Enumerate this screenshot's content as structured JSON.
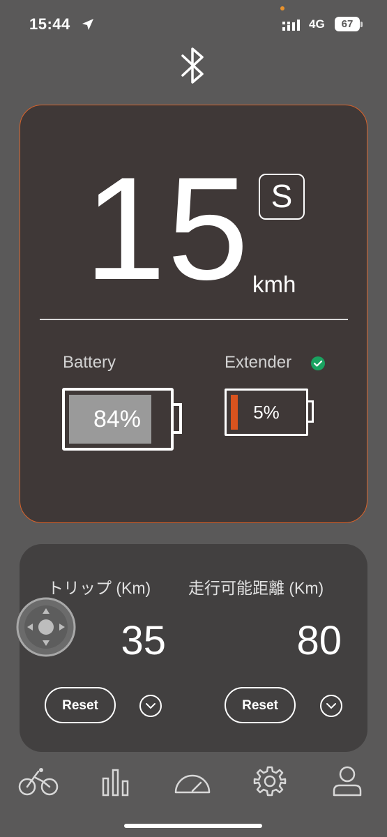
{
  "status_bar": {
    "time": "15:44",
    "network": "4G",
    "battery": "67"
  },
  "speed_card": {
    "speed": "15",
    "mode": "S",
    "unit": "kmh",
    "battery_label": "Battery",
    "battery_percent": "84%",
    "battery_level": 0.84,
    "extender_label": "Extender",
    "extender_percent": "5%",
    "extender_level": 0.05
  },
  "trip_card": {
    "trip_label": "トリップ (Km)",
    "trip_value": "35",
    "range_label": "走行可能距離 (Km)",
    "range_value": "80",
    "reset_label": "Reset"
  },
  "icons": {
    "bluetooth": "bluetooth-icon",
    "location": "location-arrow-icon",
    "check": "check-circle-icon",
    "joystick": "joystick-icon",
    "nav": [
      "bike-icon",
      "bar-chart-icon",
      "speedometer-icon",
      "gear-icon",
      "profile-icon"
    ]
  },
  "colors": {
    "background": "#5a5959",
    "card": "#3f3837",
    "card_border": "#d9622a",
    "extender_fill": "#d9531e",
    "check": "#1aa260"
  }
}
